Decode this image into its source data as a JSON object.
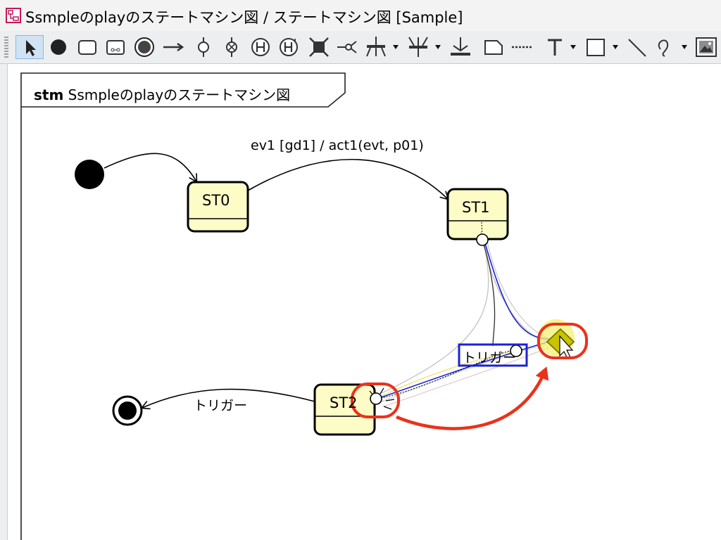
{
  "window": {
    "title": "Ssmpleのplayのステートマシン図 / ステートマシン図 [Sample]",
    "icon": "state-diagram-icon"
  },
  "toolbar": {
    "tools": [
      {
        "name": "select-tool",
        "icon": "pointer-arrow-icon",
        "selected": true
      },
      {
        "name": "initial-state-tool",
        "icon": "filled-circle-icon"
      },
      {
        "name": "state-tool",
        "icon": "rounded-rect-icon"
      },
      {
        "name": "submachine-state-tool",
        "icon": "submachine-icon"
      },
      {
        "name": "final-state-tool",
        "icon": "bullseye-icon"
      },
      {
        "name": "transition-tool",
        "icon": "arrow-right-icon"
      },
      {
        "name": "entry-point-tool",
        "icon": "pin-circle-icon"
      },
      {
        "name": "exit-point-tool",
        "icon": "crossed-circle-icon"
      },
      {
        "name": "shallow-history-tool",
        "icon": "history-h-icon"
      },
      {
        "name": "deep-history-tool",
        "icon": "deep-history-h-icon"
      },
      {
        "name": "choice-tool",
        "icon": "choice-icon"
      },
      {
        "name": "junction-tool",
        "icon": "junction-icon"
      },
      {
        "name": "fork-tool",
        "icon": "fork-icon",
        "dropdown": true
      },
      {
        "name": "join-tool",
        "icon": "join-icon",
        "dropdown": true
      },
      {
        "name": "terminate-tool",
        "icon": "terminate-icon"
      },
      {
        "name": "note-tool",
        "icon": "note-icon"
      },
      {
        "name": "note-anchor-tool",
        "icon": "dotted-line-icon"
      },
      {
        "name": "text-tool",
        "icon": "text-t-icon",
        "dropdown": true
      },
      {
        "name": "rectangle-tool",
        "icon": "rectangle-icon",
        "dropdown": true
      },
      {
        "name": "line-tool",
        "icon": "diagonal-line-icon"
      },
      {
        "name": "freehand-tool",
        "icon": "squiggle-icon",
        "dropdown": true
      },
      {
        "name": "image-tool",
        "icon": "image-icon"
      }
    ]
  },
  "diagram": {
    "frame_keyword": "stm",
    "frame_name": "Ssmpleのplayのステートマシン図",
    "states": [
      {
        "id": "st0",
        "name": "ST0"
      },
      {
        "id": "st1",
        "name": "ST1"
      },
      {
        "id": "st2",
        "name": "ST2"
      }
    ],
    "transitions": [
      {
        "id": "t-st0-st1",
        "label": "ev1 [gd1] / act1(evt, p01)"
      },
      {
        "id": "t-st2-final",
        "label": "トリガー"
      },
      {
        "id": "t-st1-st2",
        "label": "トリガー"
      }
    ],
    "colors": {
      "state_fill": "#fdfcc6",
      "selection_box": "#1a22d6",
      "highlight_red": "#e8331b",
      "target_yellow": "#c8c400"
    }
  }
}
